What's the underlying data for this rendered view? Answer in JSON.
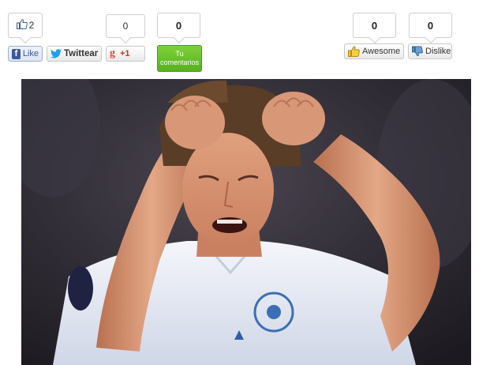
{
  "facebook": {
    "count": "2",
    "label": "Like"
  },
  "twitter": {
    "label": "Twittear"
  },
  "google": {
    "count": "0",
    "label": "+1",
    "g": "g"
  },
  "comments": {
    "count": "0",
    "label_line1": "Tu",
    "label_line2": "comentarios"
  },
  "reactions": [
    {
      "count": "0",
      "label": "Awesome",
      "icon": "thumbs-up-icon"
    },
    {
      "count": "0",
      "label": "Dislike",
      "icon": "thumbs-down-icon"
    }
  ],
  "photo": {
    "subject": "footballer-in-white-jersey"
  },
  "colors": {
    "facebook": "#3b5998",
    "twitter": "#1da1f2",
    "google": "#dd4b39",
    "comment_green": "#5cbf2a"
  }
}
